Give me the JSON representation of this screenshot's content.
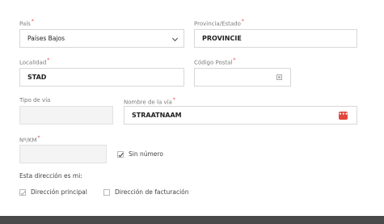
{
  "required_marker": "*",
  "pais": {
    "label": "País",
    "value": "Países Bajos"
  },
  "provincia": {
    "label": "Provincia/Estado",
    "value": "PROVINCIE"
  },
  "localidad": {
    "label": "Localidad",
    "value": "STAD"
  },
  "codigo_postal": {
    "label": "Código Postal",
    "value": ""
  },
  "tipo_via": {
    "label": "Tipo de vía",
    "value": ""
  },
  "nombre_via": {
    "label": "Nombre de la vía",
    "value": "STRAATNAAM",
    "action_icon": "more-dots-icon"
  },
  "numero": {
    "label": "Nº/KM",
    "value": ""
  },
  "sin_numero": {
    "label": "Sin número",
    "checked": true
  },
  "direccion": {
    "title": "Esta dirección es mi:",
    "principal": {
      "label": "Dirección principal",
      "checked": true
    },
    "facturacion": {
      "label": "Dirección de facturación",
      "checked": false
    }
  },
  "colors": {
    "required": "#e04b4b",
    "action_icon_bg": "#e2463c",
    "footer": "#4a4a4a"
  }
}
